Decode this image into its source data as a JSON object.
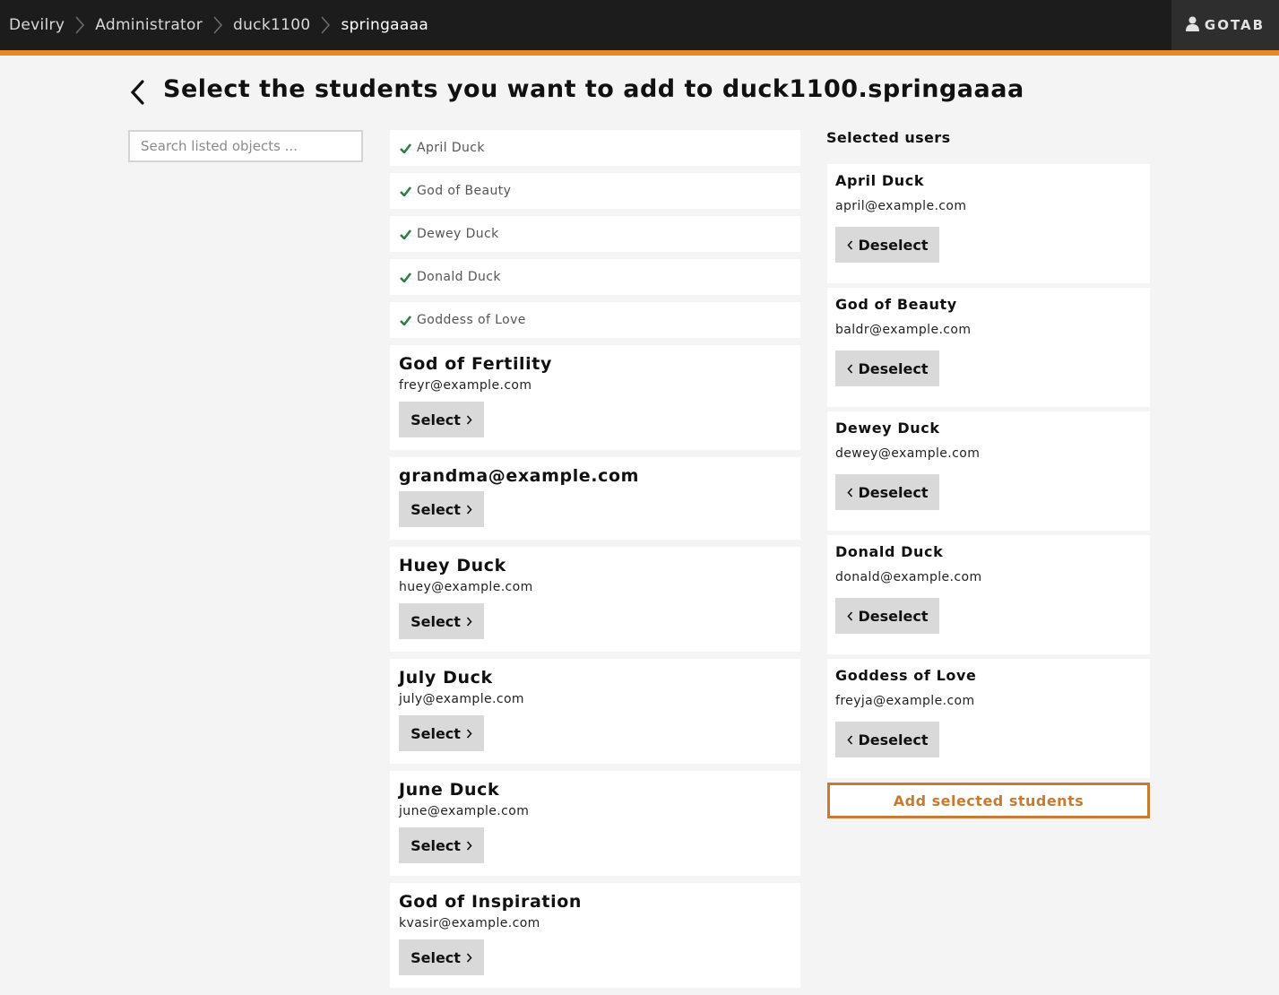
{
  "breadcrumb": [
    {
      "label": "Devilry"
    },
    {
      "label": "Administrator"
    },
    {
      "label": "duck1100"
    },
    {
      "label": "springaaaa"
    }
  ],
  "user_menu": {
    "label": "GOTAB",
    "icon": "user-icon"
  },
  "page": {
    "title": "Select the students you want to add to duck1100.springaaaa"
  },
  "search": {
    "placeholder": "Search listed objects ..."
  },
  "listed": {
    "already_selected": [
      {
        "name": "April Duck"
      },
      {
        "name": "God of Beauty"
      },
      {
        "name": "Dewey Duck"
      },
      {
        "name": "Donald Duck"
      },
      {
        "name": "Goddess of Love"
      }
    ],
    "candidates": [
      {
        "name": "God of Fertility",
        "email": "freyr@example.com",
        "button": "Select"
      },
      {
        "name": "grandma@example.com",
        "email": "",
        "button": "Select"
      },
      {
        "name": "Huey Duck",
        "email": "huey@example.com",
        "button": "Select"
      },
      {
        "name": "July Duck",
        "email": "july@example.com",
        "button": "Select"
      },
      {
        "name": "June Duck",
        "email": "june@example.com",
        "button": "Select"
      },
      {
        "name": "God of Inspiration",
        "email": "kvasir@example.com",
        "button": "Select"
      }
    ]
  },
  "selected": {
    "heading": "Selected users",
    "users": [
      {
        "name": "April Duck",
        "email": "april@example.com",
        "button": "Deselect"
      },
      {
        "name": "God of Beauty",
        "email": "baldr@example.com",
        "button": "Deselect"
      },
      {
        "name": "Dewey Duck",
        "email": "dewey@example.com",
        "button": "Deselect"
      },
      {
        "name": "Donald Duck",
        "email": "donald@example.com",
        "button": "Deselect"
      },
      {
        "name": "Goddess of Love",
        "email": "freyja@example.com",
        "button": "Deselect"
      }
    ],
    "add_button": "Add selected students"
  },
  "colors": {
    "accent": "#e8862a",
    "topbar": "#1c1c1c",
    "check": "#2e7d4a",
    "add_button": "#c97a2e"
  }
}
